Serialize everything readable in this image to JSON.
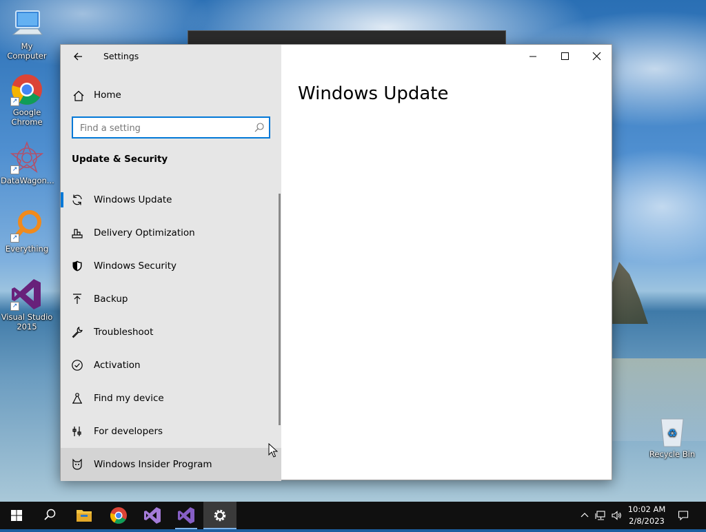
{
  "desktop": {
    "icons": [
      {
        "label": "My Computer",
        "icon": "computer-icon"
      },
      {
        "label": "Google Chrome",
        "icon": "chrome-icon"
      },
      {
        "label": "DataWagon...",
        "icon": "datawagon-icon"
      },
      {
        "label": "Everything",
        "icon": "everything-search-icon"
      },
      {
        "label": "Visual Studio 2015",
        "icon": "visual-studio-icon"
      },
      {
        "label": "Recycle Bin",
        "icon": "recycle-bin-icon"
      }
    ]
  },
  "settings": {
    "app_title": "Settings",
    "home_label": "Home",
    "search_placeholder": "Find a setting",
    "section_header": "Update & Security",
    "nav_items": [
      {
        "label": "Windows Update",
        "icon": "sync-icon",
        "selected": true
      },
      {
        "label": "Delivery Optimization",
        "icon": "delivery-optimization-icon"
      },
      {
        "label": "Windows Security",
        "icon": "shield-icon"
      },
      {
        "label": "Backup",
        "icon": "backup-arrow-icon"
      },
      {
        "label": "Troubleshoot",
        "icon": "wrench-icon"
      },
      {
        "label": "Activation",
        "icon": "check-circle-icon"
      },
      {
        "label": "Find my device",
        "icon": "find-device-icon"
      },
      {
        "label": "For developers",
        "icon": "developer-tools-icon"
      },
      {
        "label": "Windows Insider Program",
        "icon": "insider-cat-icon",
        "hovered": true
      }
    ],
    "page_title": "Windows Update",
    "accent_color": "#0078d7"
  },
  "taskbar": {
    "apps": [
      "start-icon",
      "search-icon",
      "file-explorer-icon",
      "chrome-icon",
      "visual-studio-icon",
      "visual-studio-2015-icon",
      "settings-gear-icon"
    ],
    "clock_time": "10:02 AM",
    "clock_date": "2/8/2023"
  }
}
